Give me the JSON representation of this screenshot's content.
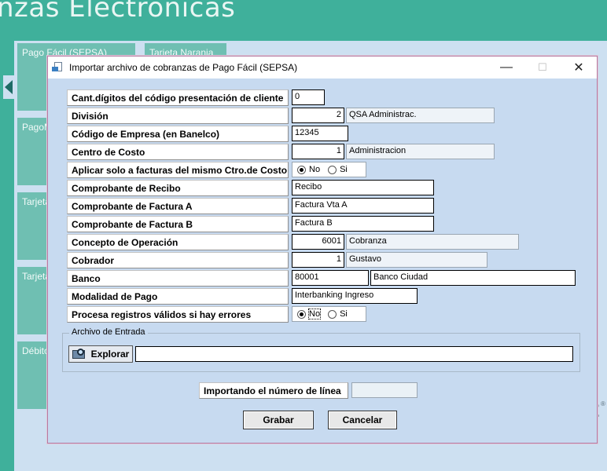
{
  "background": {
    "app_title": "nzas Electrónicas",
    "tiles": [
      "Pago Fácil (SEPSA)",
      "Tarjeta Naranja",
      "PagoM",
      "Tarjeta",
      "Tarjeta",
      "Débito"
    ],
    "logo_fragment": "t",
    "logo_mark": "®"
  },
  "dialog": {
    "title": "Importar archivo de cobranzas de Pago Fácil  (SEPSA)",
    "controls": {
      "minimize": "—",
      "maximize": "☐",
      "close": "✕"
    },
    "fields": {
      "digitos": {
        "label": "Cant.dígitos del código presentación de cliente",
        "value": "0"
      },
      "division": {
        "label": "División",
        "code": "2",
        "name": "QSA Administrac."
      },
      "empresa": {
        "label": "Código de Empresa (en Banelco)",
        "value": "12345"
      },
      "centro_costo": {
        "label": "Centro de Costo",
        "code": "1",
        "name": "Administracion"
      },
      "aplicar": {
        "label": "Aplicar solo a facturas del mismo Ctro.de Costo",
        "opt_no": "No",
        "opt_si": "Si",
        "selected": "No"
      },
      "recibo": {
        "label": "Comprobante de Recibo",
        "value": "Recibo"
      },
      "factura_a": {
        "label": "Comprobante de Factura A",
        "value": "Factura Vta A"
      },
      "factura_b": {
        "label": "Comprobante de Factura B",
        "value": "Factura B"
      },
      "concepto": {
        "label": "Concepto de Operación",
        "code": "6001",
        "name": "Cobranza"
      },
      "cobrador": {
        "label": "Cobrador",
        "code": "1",
        "name": "Gustavo"
      },
      "banco": {
        "label": "Banco",
        "code": "80001",
        "name": "Banco Ciudad"
      },
      "modalidad": {
        "label": "Modalidad de Pago",
        "value": "Interbanking Ingreso"
      },
      "procesa": {
        "label": "Procesa registros válidos si hay errores",
        "opt_no": "No",
        "opt_si": "Si",
        "selected": "No"
      }
    },
    "archivo": {
      "legend": "Archivo de Entrada",
      "explorar": "Explorar",
      "path": ""
    },
    "status": {
      "label": "Importando el número de línea",
      "value": ""
    },
    "buttons": {
      "grabar": "Grabar",
      "cancelar": "Cancelar"
    }
  }
}
